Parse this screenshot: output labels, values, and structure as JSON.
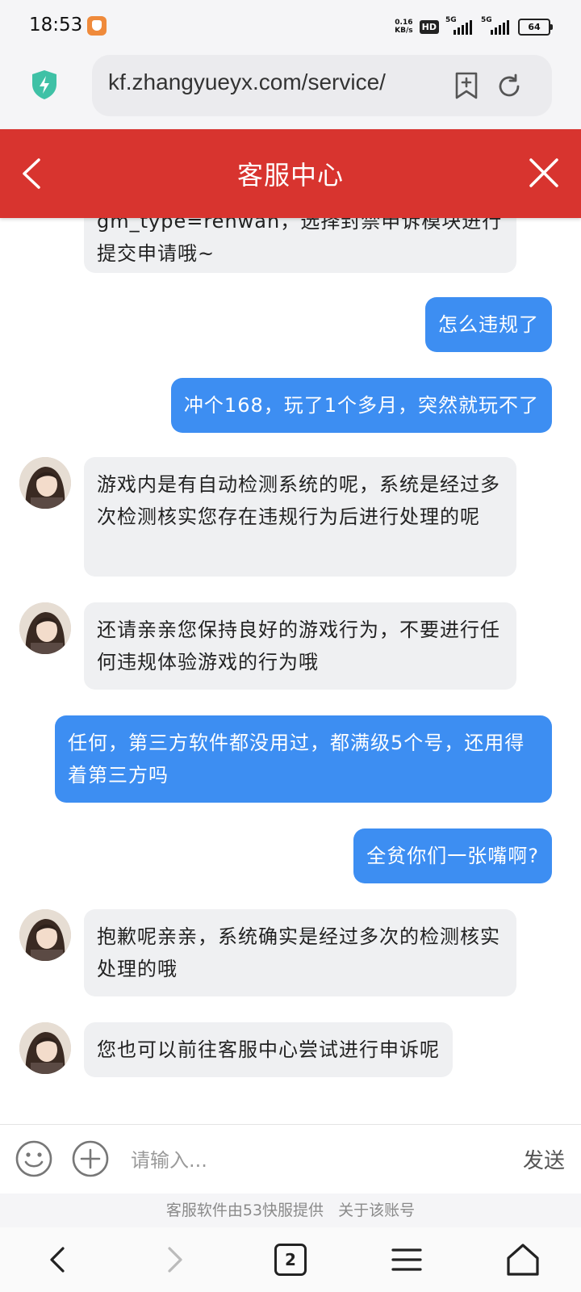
{
  "status_bar": {
    "time": "18:53",
    "speed_value": "0.16",
    "speed_unit": "KB/s",
    "hd_label": "HD",
    "signal1_label": "5G",
    "signal2_label": "5G",
    "battery": "64"
  },
  "browser": {
    "url": "kf.zhangyueyx.com/service/"
  },
  "header": {
    "title": "客服中心"
  },
  "messages": [
    {
      "side": "left",
      "text": "gm_type=renwan，选择封禁申诉模块进行提交申请哦~",
      "partial": true
    },
    {
      "side": "right",
      "text": "怎么违规了"
    },
    {
      "side": "right",
      "text": "冲个168，玩了1个多月，突然就玩不了"
    },
    {
      "side": "left",
      "text": "游戏内是有自动检测系统的呢，系统是经过多次检测核实您存在违规行为后进行处理的呢"
    },
    {
      "side": "left",
      "text": "还请亲亲您保持良好的游戏行为，不要进行任何违规体验游戏的行为哦"
    },
    {
      "side": "right",
      "text": "任何，第三方软件都没用过，都满级5个号，还用得着第三方吗"
    },
    {
      "side": "right",
      "text": "全贫你们一张嘴啊?"
    },
    {
      "side": "left",
      "text": "抱歉呢亲亲，系统确实是经过多次的检测核实处理的哦"
    },
    {
      "side": "left",
      "text": "您也可以前往客服中心尝试进行申诉呢"
    }
  ],
  "input": {
    "placeholder": "请输入...",
    "send_label": "发送"
  },
  "footer": {
    "provider": "客服软件由53快服提供",
    "about": "关于该账号"
  },
  "bottom_nav": {
    "tabs_count": "2"
  },
  "colors": {
    "header_bg": "#d8342f",
    "user_bubble": "#3d8ef2",
    "agent_bubble": "#eff0f2"
  }
}
